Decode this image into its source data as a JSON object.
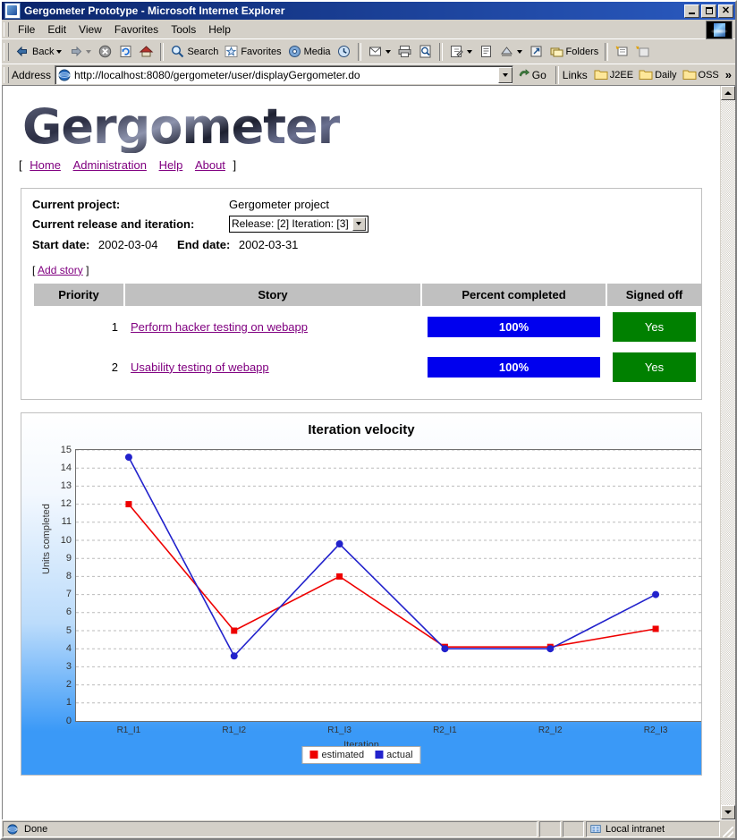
{
  "window": {
    "title": "Gergometer Prototype - Microsoft Internet Explorer",
    "minimize_label": "_",
    "maximize_label": "□",
    "close_label": "×"
  },
  "menu": {
    "items": [
      {
        "label": "File"
      },
      {
        "label": "Edit"
      },
      {
        "label": "View"
      },
      {
        "label": "Favorites"
      },
      {
        "label": "Tools"
      },
      {
        "label": "Help"
      }
    ]
  },
  "toolbar": {
    "back_label": "Back",
    "forward_label": "",
    "stop_label": "",
    "refresh_label": "",
    "home_label": "",
    "search_label": "Search",
    "favorites_label": "Favorites",
    "media_label": "Media",
    "history_label": "",
    "mail_label": "",
    "print_label": "",
    "edit_label": "",
    "discuss_label": "",
    "research_label": "",
    "messenger_label": "",
    "folders_label": "Folders",
    "overflow_label": "»"
  },
  "address": {
    "label": "Address",
    "value": "http://localhost:8080/gergometer/user/displayGergometer.do",
    "placeholder": "",
    "go_label": "Go",
    "links_label": "Links",
    "link_items": [
      {
        "label": "J2EE"
      },
      {
        "label": "Daily"
      },
      {
        "label": "OSS"
      }
    ],
    "overflow_label": "»"
  },
  "site": {
    "logo_text": "Gergometer",
    "nav_open": "[",
    "nav_close": "]",
    "nav": [
      {
        "label": "Home"
      },
      {
        "label": "Administration"
      },
      {
        "label": "Help"
      },
      {
        "label": "About"
      }
    ]
  },
  "project": {
    "current_project_label": "Current project:",
    "current_project_value": "Gergometer project",
    "release_iteration_label": "Current release and iteration:",
    "release_iteration_value": "Release: [2] Iteration: [3]",
    "release_iteration_options": [
      "Release: [2] Iteration: [3]"
    ],
    "start_date_label": "Start date:",
    "start_date_value": "2002-03-04",
    "end_date_label": "End date:",
    "end_date_value": "2002-03-31"
  },
  "stories": {
    "add_story_open": "[",
    "add_story_label": "Add story",
    "add_story_close": "]",
    "columns": [
      "Priority",
      "Story",
      "Percent completed",
      "Signed off"
    ],
    "rows": [
      {
        "priority": "1",
        "story": "Perform hacker testing on webapp",
        "percent_text": "100%",
        "percent_value": 100,
        "signed_off": "Yes"
      },
      {
        "priority": "2",
        "story": "Usability testing of webapp",
        "percent_text": "100%",
        "percent_value": 100,
        "signed_off": "Yes"
      }
    ]
  },
  "chart_data": {
    "type": "line",
    "title": "Iteration velocity",
    "xlabel": "Iteration",
    "ylabel": "Units completed",
    "categories": [
      "R1_I1",
      "R1_I2",
      "R1_I3",
      "R2_I1",
      "R2_I2",
      "R2_I3"
    ],
    "ylim": [
      0,
      15
    ],
    "yticks": [
      0,
      1,
      2,
      3,
      4,
      5,
      6,
      7,
      8,
      9,
      10,
      11,
      12,
      13,
      14,
      15
    ],
    "grid": true,
    "legend_position": "bottom",
    "series": [
      {
        "name": "estimated",
        "color": "#ee0000",
        "marker": "square",
        "values": [
          12.0,
          5.0,
          8.0,
          4.1,
          4.1,
          5.1
        ]
      },
      {
        "name": "actual",
        "color": "#2222cc",
        "marker": "circle",
        "values": [
          14.6,
          3.6,
          9.8,
          4.0,
          4.0,
          7.0
        ]
      }
    ]
  },
  "colors": {
    "progress_bar": "#0000ee",
    "signed_off_badge": "#008000",
    "link": "#800080",
    "header_bg": "#c0c0c0",
    "chart_estimated": "#ee0000",
    "chart_actual": "#2222cc",
    "titlebar": "#0a246a"
  },
  "status": {
    "message": "Done",
    "zone": "Local intranet"
  }
}
